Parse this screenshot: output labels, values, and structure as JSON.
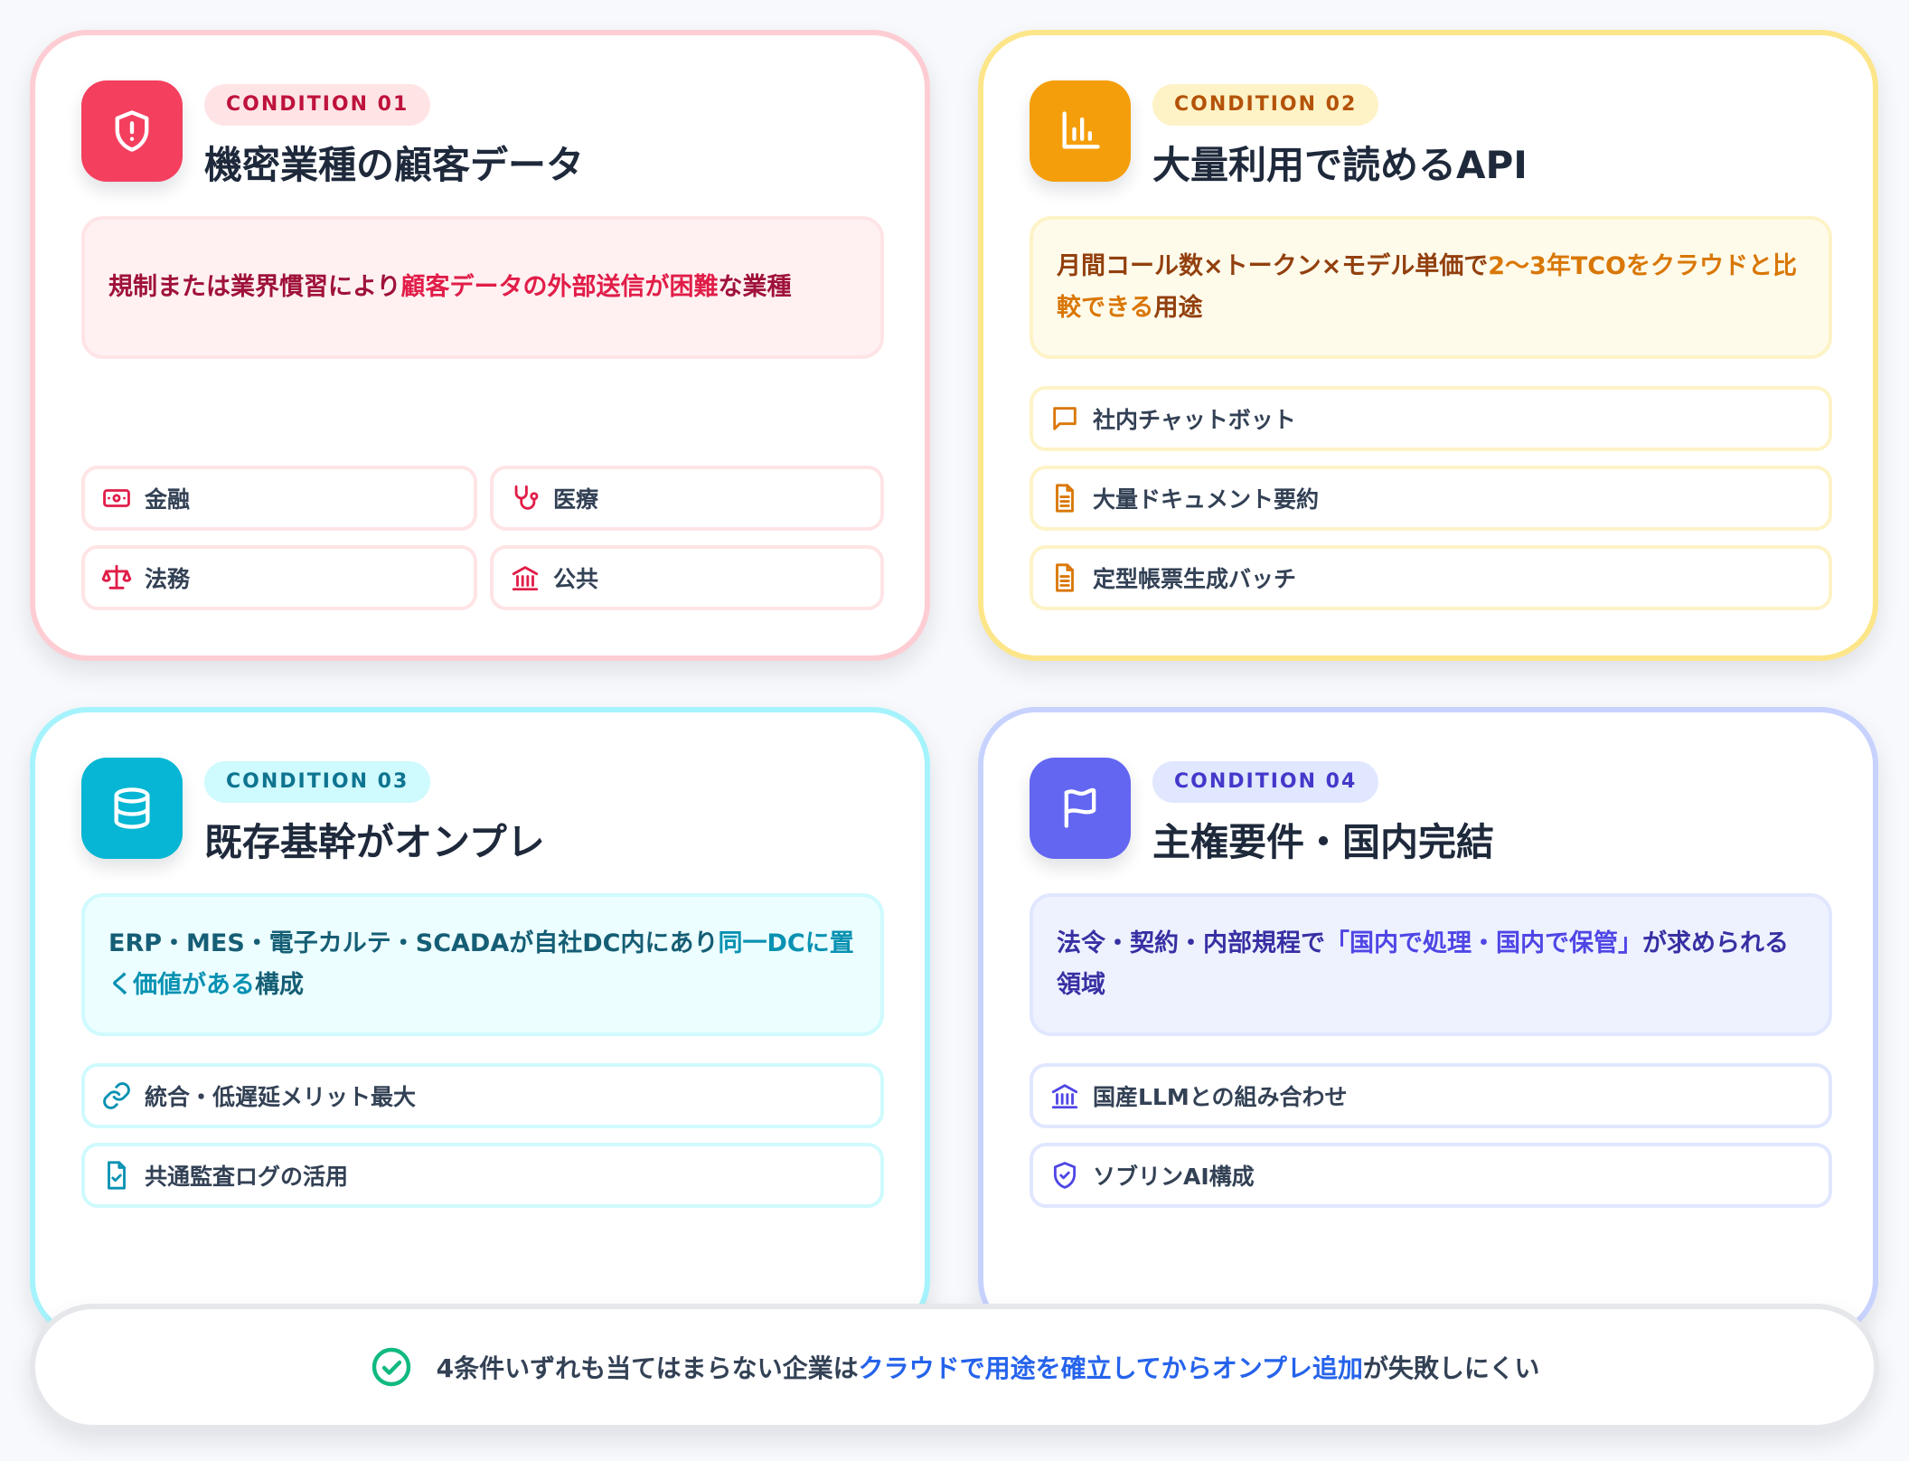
{
  "colors": {
    "rose": "#f43f5e",
    "amber": "#f59e0b",
    "cyan": "#06b6d4",
    "indigo": "#6366f1",
    "footer_highlight": "#2563eb",
    "check": "#10b981"
  },
  "cards": [
    {
      "badge": "CONDITION 01",
      "title": "機密業種の顧客データ",
      "icon": "shield-alert-icon",
      "desc": {
        "pre": "規制または業界慣習により",
        "highlight": "顧客データの外部送信が困難",
        "post": "な業種"
      },
      "items": [
        {
          "label": "金融",
          "icon": "banknote-icon"
        },
        {
          "label": "医療",
          "icon": "stethoscope-icon"
        },
        {
          "label": "法務",
          "icon": "scale-icon"
        },
        {
          "label": "公共",
          "icon": "landmark-icon"
        }
      ]
    },
    {
      "badge": "CONDITION 02",
      "title": "大量利用で読めるAPI",
      "icon": "bar-chart-icon",
      "desc": {
        "pre": "月間コール数×トークン×モデル単価で",
        "highlight": "2〜3年TCOをクラウドと比較できる",
        "post": "用途"
      },
      "items": [
        {
          "label": "社内チャットボット",
          "icon": "message-icon"
        },
        {
          "label": "大量ドキュメント要約",
          "icon": "document-icon"
        },
        {
          "label": "定型帳票生成バッチ",
          "icon": "document-icon"
        }
      ]
    },
    {
      "badge": "CONDITION 03",
      "title": "既存基幹がオンプレ",
      "icon": "database-icon",
      "desc": {
        "pre": "ERP・MES・電子カルテ・SCADAが自社DC内にあり",
        "highlight": "同一DCに置く価値がある",
        "post": "構成"
      },
      "items": [
        {
          "label": "統合・低遅延メリット最大",
          "icon": "link-icon"
        },
        {
          "label": "共通監査ログの活用",
          "icon": "file-check-icon"
        }
      ]
    },
    {
      "badge": "CONDITION 04",
      "title": "主権要件・国内完結",
      "icon": "flag-icon",
      "desc": {
        "pre": "法令・契約・内部規程で",
        "highlight": "「国内で処理・国内で保管」",
        "post": "が求められる領域"
      },
      "items": [
        {
          "label": "国産LLMとの組み合わせ",
          "icon": "landmark-icon"
        },
        {
          "label": "ソブリンAI構成",
          "icon": "shield-check-icon"
        }
      ]
    }
  ],
  "footer": {
    "icon": "check-circle-icon",
    "pre": "4条件いずれも当てはまらない企業は",
    "highlight": "クラウドで用途を確立してからオンプレ追加",
    "post": "が失敗しにくい"
  }
}
